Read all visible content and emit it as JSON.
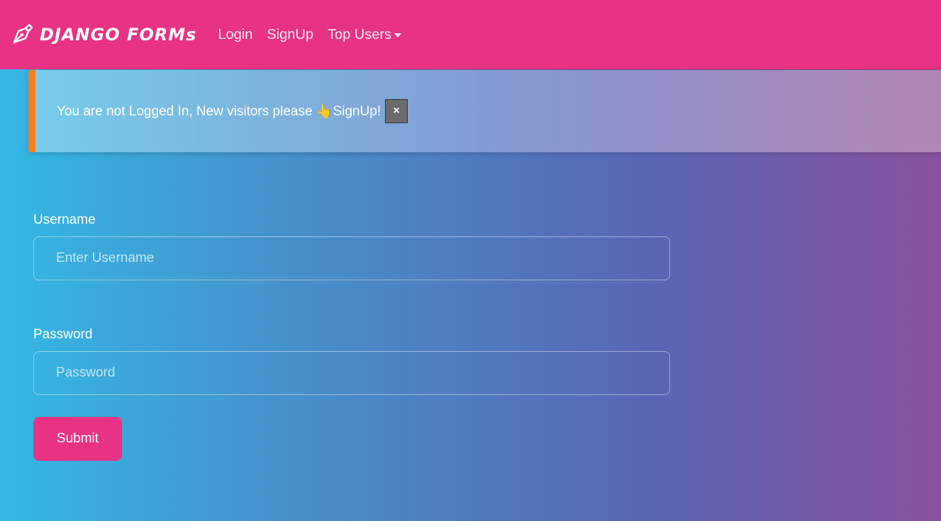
{
  "navbar": {
    "brand": "DJANGO FORMs",
    "brand_icon": "pen-nib-icon",
    "links": [
      {
        "label": "Login"
      },
      {
        "label": "SignUp"
      },
      {
        "label": "Top Users"
      }
    ]
  },
  "alert": {
    "message": "You are not Logged In, New visitors please 👆SignUp!",
    "close_label": "×"
  },
  "form": {
    "username_label": "Username",
    "username_placeholder": "Enter Username",
    "username_value": "",
    "password_label": "Password",
    "password_placeholder": "Password",
    "password_value": "",
    "submit_label": "Submit"
  },
  "colors": {
    "navbar_bg": "#e83283",
    "alert_border": "#f57f20",
    "submit_bg": "#e83283",
    "gradient_start": "#33b7e4",
    "gradient_end": "#8a53a0"
  }
}
